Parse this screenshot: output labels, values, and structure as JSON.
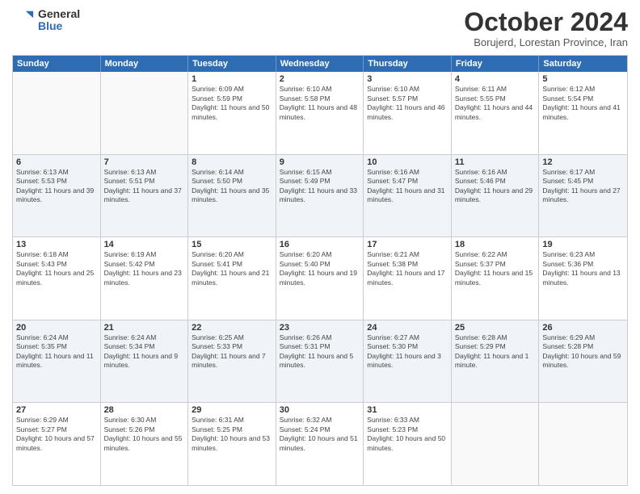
{
  "logo": {
    "general": "General",
    "blue": "Blue"
  },
  "title": "October 2024",
  "subtitle": "Borujerd, Lorestan Province, Iran",
  "headers": [
    "Sunday",
    "Monday",
    "Tuesday",
    "Wednesday",
    "Thursday",
    "Friday",
    "Saturday"
  ],
  "rows": [
    [
      {
        "day": "",
        "detail": ""
      },
      {
        "day": "",
        "detail": ""
      },
      {
        "day": "1",
        "detail": "Sunrise: 6:09 AM\nSunset: 5:59 PM\nDaylight: 11 hours and 50 minutes."
      },
      {
        "day": "2",
        "detail": "Sunrise: 6:10 AM\nSunset: 5:58 PM\nDaylight: 11 hours and 48 minutes."
      },
      {
        "day": "3",
        "detail": "Sunrise: 6:10 AM\nSunset: 5:57 PM\nDaylight: 11 hours and 46 minutes."
      },
      {
        "day": "4",
        "detail": "Sunrise: 6:11 AM\nSunset: 5:55 PM\nDaylight: 11 hours and 44 minutes."
      },
      {
        "day": "5",
        "detail": "Sunrise: 6:12 AM\nSunset: 5:54 PM\nDaylight: 11 hours and 41 minutes."
      }
    ],
    [
      {
        "day": "6",
        "detail": "Sunrise: 6:13 AM\nSunset: 5:53 PM\nDaylight: 11 hours and 39 minutes."
      },
      {
        "day": "7",
        "detail": "Sunrise: 6:13 AM\nSunset: 5:51 PM\nDaylight: 11 hours and 37 minutes."
      },
      {
        "day": "8",
        "detail": "Sunrise: 6:14 AM\nSunset: 5:50 PM\nDaylight: 11 hours and 35 minutes."
      },
      {
        "day": "9",
        "detail": "Sunrise: 6:15 AM\nSunset: 5:49 PM\nDaylight: 11 hours and 33 minutes."
      },
      {
        "day": "10",
        "detail": "Sunrise: 6:16 AM\nSunset: 5:47 PM\nDaylight: 11 hours and 31 minutes."
      },
      {
        "day": "11",
        "detail": "Sunrise: 6:16 AM\nSunset: 5:46 PM\nDaylight: 11 hours and 29 minutes."
      },
      {
        "day": "12",
        "detail": "Sunrise: 6:17 AM\nSunset: 5:45 PM\nDaylight: 11 hours and 27 minutes."
      }
    ],
    [
      {
        "day": "13",
        "detail": "Sunrise: 6:18 AM\nSunset: 5:43 PM\nDaylight: 11 hours and 25 minutes."
      },
      {
        "day": "14",
        "detail": "Sunrise: 6:19 AM\nSunset: 5:42 PM\nDaylight: 11 hours and 23 minutes."
      },
      {
        "day": "15",
        "detail": "Sunrise: 6:20 AM\nSunset: 5:41 PM\nDaylight: 11 hours and 21 minutes."
      },
      {
        "day": "16",
        "detail": "Sunrise: 6:20 AM\nSunset: 5:40 PM\nDaylight: 11 hours and 19 minutes."
      },
      {
        "day": "17",
        "detail": "Sunrise: 6:21 AM\nSunset: 5:38 PM\nDaylight: 11 hours and 17 minutes."
      },
      {
        "day": "18",
        "detail": "Sunrise: 6:22 AM\nSunset: 5:37 PM\nDaylight: 11 hours and 15 minutes."
      },
      {
        "day": "19",
        "detail": "Sunrise: 6:23 AM\nSunset: 5:36 PM\nDaylight: 11 hours and 13 minutes."
      }
    ],
    [
      {
        "day": "20",
        "detail": "Sunrise: 6:24 AM\nSunset: 5:35 PM\nDaylight: 11 hours and 11 minutes."
      },
      {
        "day": "21",
        "detail": "Sunrise: 6:24 AM\nSunset: 5:34 PM\nDaylight: 11 hours and 9 minutes."
      },
      {
        "day": "22",
        "detail": "Sunrise: 6:25 AM\nSunset: 5:33 PM\nDaylight: 11 hours and 7 minutes."
      },
      {
        "day": "23",
        "detail": "Sunrise: 6:26 AM\nSunset: 5:31 PM\nDaylight: 11 hours and 5 minutes."
      },
      {
        "day": "24",
        "detail": "Sunrise: 6:27 AM\nSunset: 5:30 PM\nDaylight: 11 hours and 3 minutes."
      },
      {
        "day": "25",
        "detail": "Sunrise: 6:28 AM\nSunset: 5:29 PM\nDaylight: 11 hours and 1 minute."
      },
      {
        "day": "26",
        "detail": "Sunrise: 6:29 AM\nSunset: 5:28 PM\nDaylight: 10 hours and 59 minutes."
      }
    ],
    [
      {
        "day": "27",
        "detail": "Sunrise: 6:29 AM\nSunset: 5:27 PM\nDaylight: 10 hours and 57 minutes."
      },
      {
        "day": "28",
        "detail": "Sunrise: 6:30 AM\nSunset: 5:26 PM\nDaylight: 10 hours and 55 minutes."
      },
      {
        "day": "29",
        "detail": "Sunrise: 6:31 AM\nSunset: 5:25 PM\nDaylight: 10 hours and 53 minutes."
      },
      {
        "day": "30",
        "detail": "Sunrise: 6:32 AM\nSunset: 5:24 PM\nDaylight: 10 hours and 51 minutes."
      },
      {
        "day": "31",
        "detail": "Sunrise: 6:33 AM\nSunset: 5:23 PM\nDaylight: 10 hours and 50 minutes."
      },
      {
        "day": "",
        "detail": ""
      },
      {
        "day": "",
        "detail": ""
      }
    ]
  ]
}
